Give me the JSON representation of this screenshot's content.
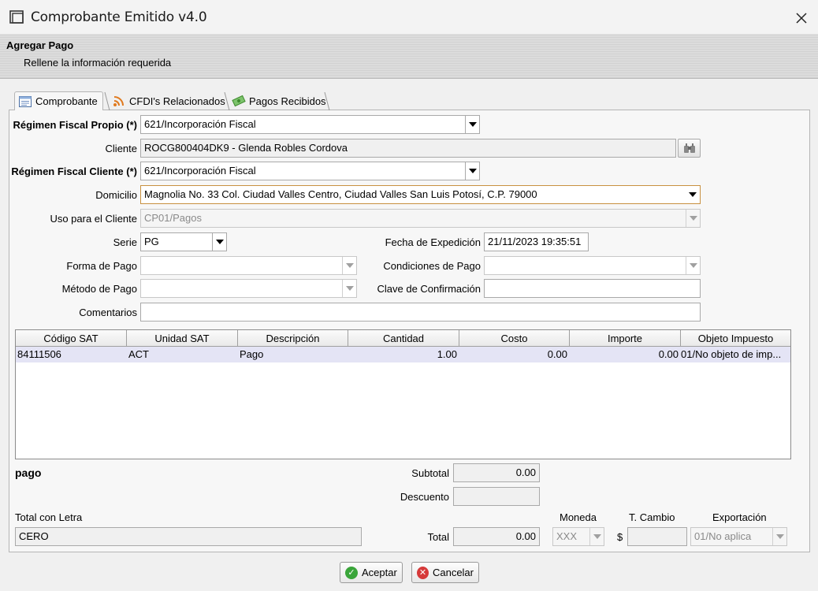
{
  "window": {
    "title": "Comprobante Emitido v4.0",
    "close_glyph": "✕"
  },
  "header": {
    "title": "Agregar Pago",
    "subtitle": "Rellene la información requerida"
  },
  "tabs": [
    {
      "label": "Comprobante",
      "icon": "document-icon",
      "active": true
    },
    {
      "label": "CFDI's Relacionados",
      "icon": "rss-icon",
      "active": false
    },
    {
      "label": "Pagos Recibidos",
      "icon": "money-icon",
      "active": false
    }
  ],
  "form": {
    "regimen_propio_label": "Régimen Fiscal Propio (*)",
    "regimen_propio_value": "621/Incorporación Fiscal",
    "cliente_label": "Cliente",
    "cliente_value": "ROCG800404DK9 - Glenda Robles Cordova",
    "regimen_cliente_label": "Régimen Fiscal Cliente (*)",
    "regimen_cliente_value": "621/Incorporación Fiscal",
    "domicilio_label": "Domicilio",
    "domicilio_value": "Magnolia No. 33 Col. Ciudad Valles Centro, Ciudad Valles San Luis Potosí, C.P. 79000",
    "uso_label": "Uso para el Cliente",
    "uso_value": "CP01/Pagos",
    "serie_label": "Serie",
    "serie_value": "PG",
    "fecha_label": "Fecha de Expedición",
    "fecha_value": "21/11/2023 19:35:51",
    "forma_pago_label": "Forma de Pago",
    "forma_pago_value": "",
    "condiciones_label": "Condiciones de Pago",
    "condiciones_value": "",
    "metodo_label": "Método de Pago",
    "metodo_value": "",
    "clave_label": "Clave de Confirmación",
    "clave_value": "",
    "comentarios_label": "Comentarios",
    "comentarios_value": ""
  },
  "table": {
    "columns": [
      "Código SAT",
      "Unidad SAT",
      "Descripción",
      "Cantidad",
      "Costo",
      "Importe",
      "Objeto Impuesto"
    ],
    "rows": [
      [
        "84111506",
        "ACT",
        "Pago",
        "1.00",
        "0.00",
        "0.00",
        "01/No objeto de imp..."
      ]
    ]
  },
  "summary": {
    "concept": "pago",
    "subtotal_label": "Subtotal",
    "subtotal_value": "0.00",
    "descuento_label": "Descuento",
    "descuento_value": "",
    "total_letra_label": "Total con Letra",
    "total_letra_value": "CERO",
    "total_label": "Total",
    "total_value": "0.00",
    "moneda_label": "Moneda",
    "moneda_value": "XXX",
    "tcambio_label": "T. Cambio",
    "currency_symbol": "$",
    "tcambio_value": "",
    "exportacion_label": "Exportación",
    "exportacion_value": "01/No aplica"
  },
  "buttons": {
    "accept": "Aceptar",
    "cancel": "Cancelar"
  },
  "colors": {
    "accept_icon": "#3aa53a",
    "cancel_icon": "#d63a3a",
    "row_highlight": "#e4e4f5"
  }
}
